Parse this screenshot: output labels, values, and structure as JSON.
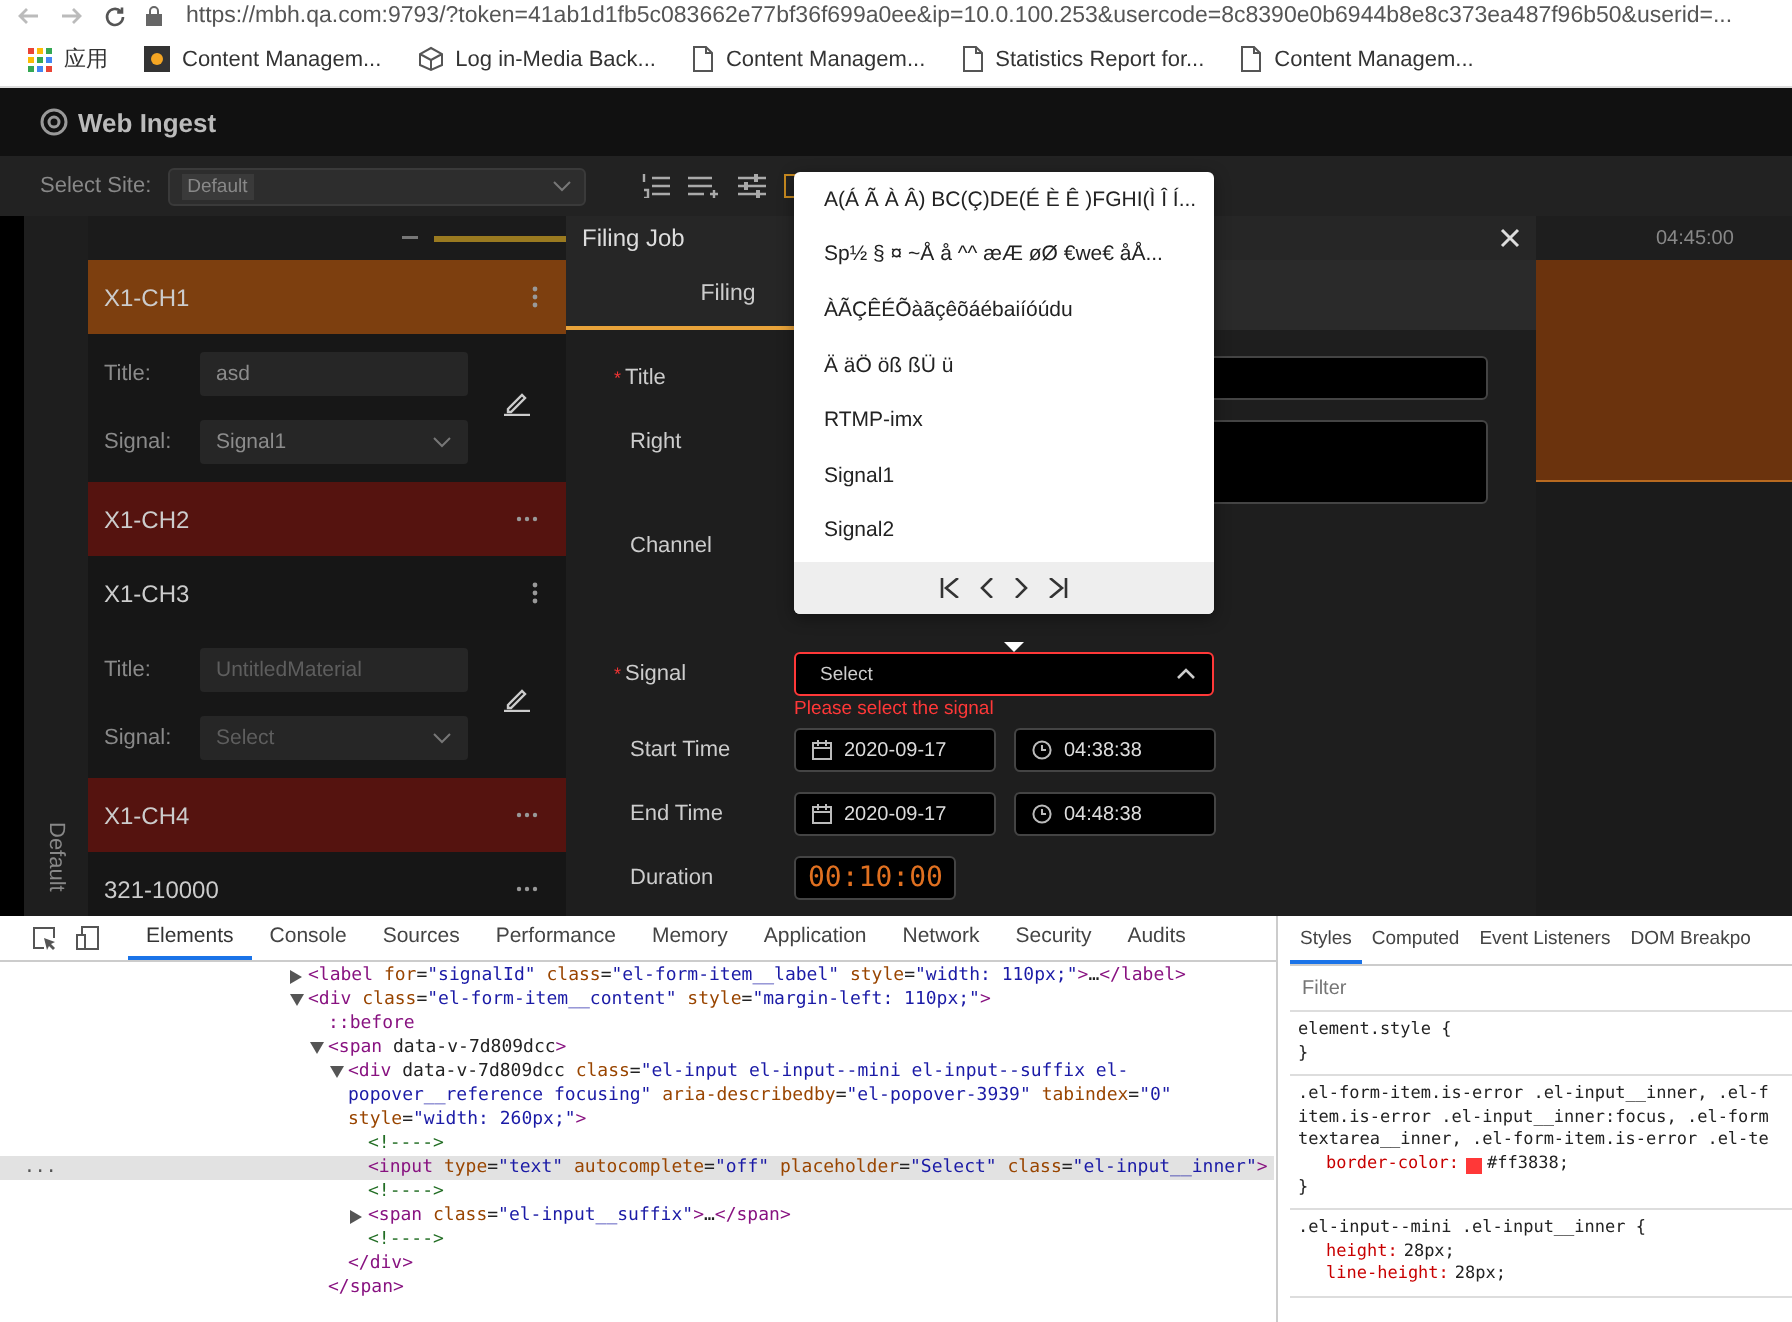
{
  "browser": {
    "url": "https://mbh.qa.com:9793/?token=41ab1d1fb5c083662e77bf36f699a0ee&ip=10.0.100.253&usercode=8c8390e0b6944b8e8c373ea487f96b50&userid=...",
    "bookmarks": [
      {
        "kind": "apps",
        "label": "应用"
      },
      {
        "kind": "logo",
        "label": "Content Managem..."
      },
      {
        "kind": "cube",
        "label": "Log in-Media Back..."
      },
      {
        "kind": "page",
        "label": "Content Managem..."
      },
      {
        "kind": "page",
        "label": "Statistics Report for..."
      },
      {
        "kind": "page",
        "label": "Content Managem..."
      }
    ]
  },
  "app": {
    "name": "Web Ingest",
    "site_label": "Select Site:",
    "site_value": "Default"
  },
  "sidebar": {
    "group_label": "Default",
    "channels": [
      {
        "name": "X1-CH1",
        "color": "#7d3f0f",
        "expanded": true,
        "fields": [
          {
            "kind": "text",
            "label": "Title:",
            "value": "asd"
          },
          {
            "kind": "select",
            "label": "Signal:",
            "value": "Signal1"
          }
        ]
      },
      {
        "name": "X1-CH2",
        "color": "#55130f",
        "expanded": false
      },
      {
        "name": "X1-CH3",
        "expanded": true,
        "fields": [
          {
            "kind": "text",
            "label": "Title:",
            "placeholder": "UntitledMaterial"
          },
          {
            "kind": "select",
            "label": "Signal:",
            "placeholder": "Select"
          }
        ]
      },
      {
        "name": "X1-CH4",
        "color": "#55130f",
        "expanded": false
      },
      {
        "name": "321-10000",
        "expanded": false
      }
    ]
  },
  "dialog": {
    "title": "Filing Job",
    "required_mark": "*",
    "tabs": [
      {
        "label": "Filing",
        "selected": true
      }
    ],
    "rows": [
      {
        "kind": "text",
        "label": "Title",
        "required": true
      },
      {
        "kind": "textarea",
        "label": "Right",
        "required": false
      },
      {
        "kind": "empty",
        "label": "Channel",
        "required": false
      },
      {
        "kind": "select",
        "label": "Signal",
        "required": true,
        "placeholder": "Select",
        "error": "Please select the signal",
        "open": true
      },
      {
        "kind": "datetime",
        "label": "Start Time",
        "required": false,
        "date": "2020-09-17",
        "time": "04:38:38"
      },
      {
        "kind": "datetime",
        "label": "End Time",
        "required": false,
        "date": "2020-09-17",
        "time": "04:48:38"
      },
      {
        "kind": "duration",
        "label": "Duration",
        "required": false,
        "value": "00:10:00"
      }
    ]
  },
  "popover": {
    "options": [
      "A(Á Ã À Â) BC(Ç)DE(É È Ê )FGHI(Ì Î Í...",
      "Sp½ § ¤ ~Å å ^^ æÆ øØ €we€ åÅ...",
      "ÀÃÇÊÉÕàãçêõáébaiíóúdu",
      "Ä äÖ öß ßÜ ü",
      "RTMP-imx",
      "Signal1",
      "Signal2"
    ]
  },
  "timeline": {
    "tick": "04:45:00"
  },
  "devtools": {
    "tabs": [
      {
        "label": "Elements",
        "selected": true
      },
      {
        "label": "Console",
        "selected": false
      },
      {
        "label": "Sources",
        "selected": false
      },
      {
        "label": "Performance",
        "selected": false
      },
      {
        "label": "Memory",
        "selected": false
      },
      {
        "label": "Application",
        "selected": false
      },
      {
        "label": "Network",
        "selected": false
      },
      {
        "label": "Security",
        "selected": false
      },
      {
        "label": "Audits",
        "selected": false
      }
    ],
    "gutter_mark": "...",
    "dom": [
      {
        "text": "<label for=\"signalId\" class=\"el-form-item__label\" style=\"width: 110px;\">…</label>",
        "expanded": false,
        "selected": false
      },
      {
        "text": "<div class=\"el-form-item__content\" style=\"margin-left: 110px;\">",
        "expanded": true,
        "selected": false,
        "children": [
          {
            "text": "::before",
            "selected": false
          },
          {
            "text": "<span data-v-7d809dcc>",
            "expanded": true,
            "selected": false,
            "closing": "</span>",
            "children": [
              {
                "text": "<div data-v-7d809dcc class=\"el-input el-input--mini el-input--suffix el-popover__reference focusing\" aria-describedby=\"el-popover-3939\" tabindex=\"0\" style=\"width: 260px;\">",
                "expanded": true,
                "selected": false,
                "closing": "</div>",
                "children": [
                  {
                    "text": "<!---->",
                    "selected": false
                  },
                  {
                    "text": "<input type=\"text\" autocomplete=\"off\" placeholder=\"Select\" class=\"el-input__inner\">",
                    "selected": true
                  },
                  {
                    "text": "<!---->",
                    "selected": false
                  },
                  {
                    "text": "<span class=\"el-input__suffix\">…</span>",
                    "expanded": false,
                    "selected": false
                  },
                  {
                    "text": "<!---->",
                    "selected": false
                  }
                ]
              }
            ]
          }
        ]
      }
    ],
    "style_tabs": [
      {
        "label": "Styles",
        "selected": true
      },
      {
        "label": "Computed",
        "selected": false
      },
      {
        "label": "Event Listeners",
        "selected": false
      },
      {
        "label": "DOM Breakpo",
        "selected": false
      }
    ],
    "filter_placeholder": "Filter",
    "rules": [
      {
        "selector_lines": [
          "element.style {"
        ],
        "end": "}"
      },
      {
        "selector_lines": [
          ".el-form-item.is-error .el-input__inner, .el-f",
          "item.is-error .el-input__inner:focus, .el-form",
          "textarea__inner, .el-form-item.is-error .el-te"
        ],
        "declarations": [
          {
            "property": "border-color:",
            "value": "#ff3838;",
            "color": "#ff3838"
          }
        ],
        "end": "}"
      },
      {
        "selector_lines": [
          ".el-input--mini .el-input__inner {"
        ],
        "declarations": [
          {
            "property": "height:",
            "value": "28px;"
          },
          {
            "property": "line-height:",
            "value": "28px;"
          }
        ]
      }
    ]
  }
}
